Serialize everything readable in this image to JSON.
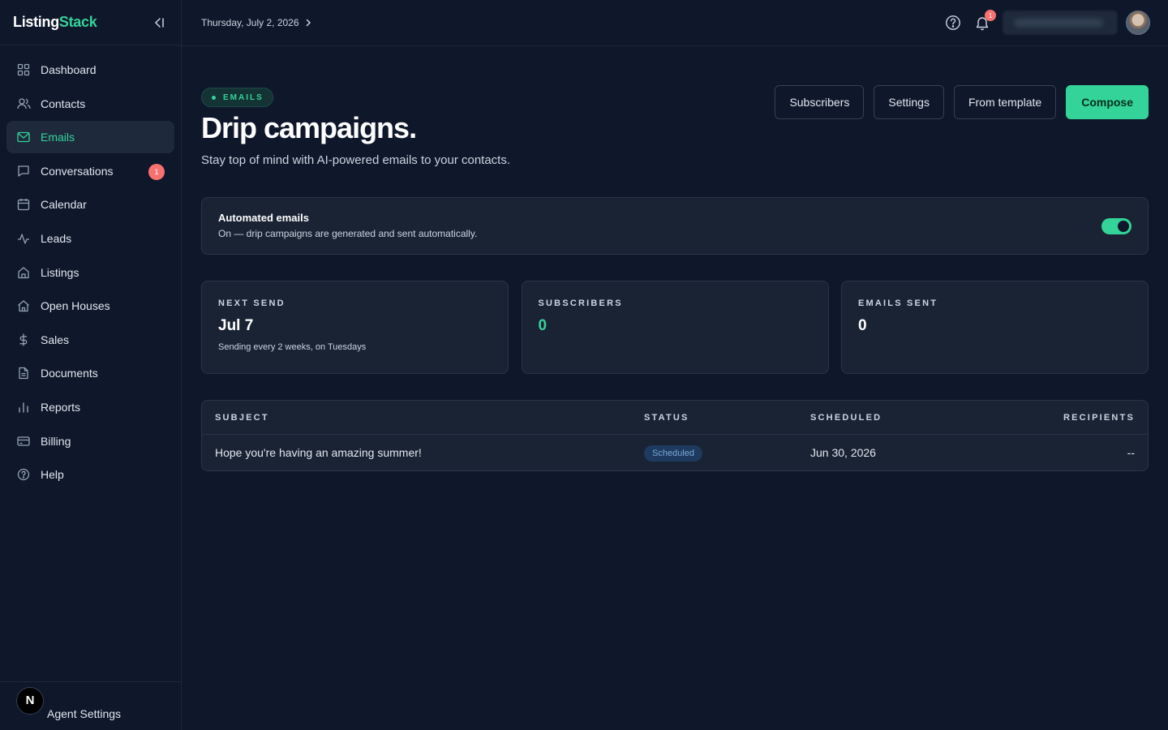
{
  "brand": {
    "part1": "Listing",
    "part2": "Stack"
  },
  "topbar": {
    "date": "Thursday, July 2, 2026",
    "notification_count": "1"
  },
  "sidebar": {
    "items": [
      {
        "label": "Dashboard",
        "icon": "grid-icon"
      },
      {
        "label": "Contacts",
        "icon": "users-icon"
      },
      {
        "label": "Emails",
        "icon": "mail-icon",
        "active": true
      },
      {
        "label": "Conversations",
        "icon": "message-icon",
        "badge": "1"
      },
      {
        "label": "Calendar",
        "icon": "calendar-icon"
      },
      {
        "label": "Leads",
        "icon": "activity-icon"
      },
      {
        "label": "Listings",
        "icon": "home-icon"
      },
      {
        "label": "Open Houses",
        "icon": "house-open-icon"
      },
      {
        "label": "Sales",
        "icon": "dollar-icon"
      },
      {
        "label": "Documents",
        "icon": "document-icon"
      },
      {
        "label": "Reports",
        "icon": "bar-chart-icon"
      },
      {
        "label": "Billing",
        "icon": "credit-card-icon"
      },
      {
        "label": "Help",
        "icon": "help-circle-icon"
      }
    ],
    "footer": {
      "avatar_letter": "N",
      "label": "Agent Settings"
    }
  },
  "header": {
    "pill": "EMAILS",
    "title": "Drip campaigns.",
    "subtitle": "Stay top of mind with AI-powered emails to your contacts.",
    "actions": {
      "subscribers": "Subscribers",
      "settings": "Settings",
      "from_template": "From template",
      "compose": "Compose"
    }
  },
  "automated": {
    "title": "Automated emails",
    "description": "On — drip campaigns are generated and sent automatically.",
    "enabled": true
  },
  "stats": {
    "next_send": {
      "label": "NEXT SEND",
      "value": "Jul 7",
      "note": "Sending every 2 weeks, on Tuesdays"
    },
    "subscribers": {
      "label": "SUBSCRIBERS",
      "value": "0"
    },
    "emails_sent": {
      "label": "EMAILS SENT",
      "value": "0"
    }
  },
  "table": {
    "columns": {
      "subject": "SUBJECT",
      "status": "STATUS",
      "scheduled": "SCHEDULED",
      "recipients": "RECIPIENTS"
    },
    "rows": [
      {
        "subject": "Hope you're having an amazing summer!",
        "status": "Scheduled",
        "scheduled": "Jun 30, 2026",
        "recipients": "--"
      }
    ]
  },
  "colors": {
    "accent": "#34d399",
    "background": "#0f172a",
    "card": "#1a2333",
    "badge": "#f87171"
  }
}
